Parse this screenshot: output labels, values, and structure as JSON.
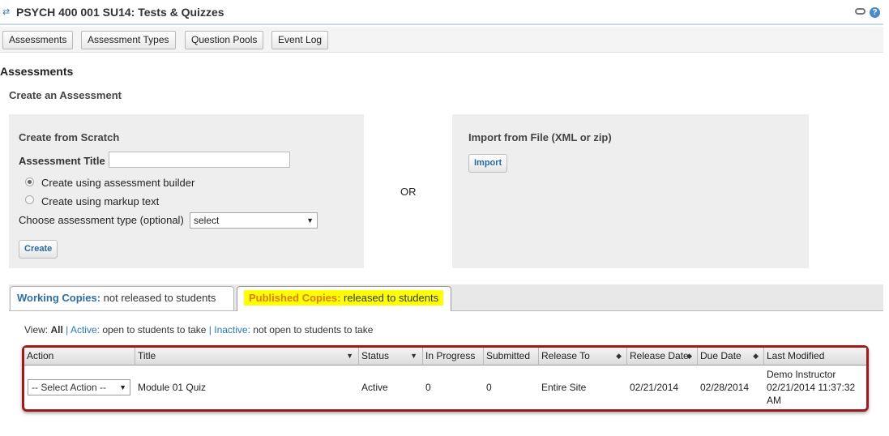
{
  "header": {
    "title": "PSYCH 400 001 SU14: Tests & Quizzes",
    "help_glyph": "?"
  },
  "nav": {
    "buttons": [
      "Assessments",
      "Assessment Types",
      "Question Pools",
      "Event Log"
    ]
  },
  "main": {
    "section_heading": "Assessments",
    "sub_heading": "Create an Assessment",
    "or_text": "OR"
  },
  "create_panel": {
    "title": "Create from Scratch",
    "title_label": "Assessment Title",
    "title_value": "",
    "radio_builder": "Create using assessment builder",
    "radio_markup": "Create using markup text",
    "selected_radio": "builder",
    "type_label": "Choose assessment type (optional)",
    "type_selected": "select",
    "create_button": "Create"
  },
  "import_panel": {
    "title": "Import from File (XML or zip)",
    "import_button": "Import"
  },
  "tabs": {
    "working_strong": "Working Copies:",
    "working_rest": "not released to students",
    "published_strong": "Published Copies:",
    "published_rest": "released to students",
    "active_tab": "published"
  },
  "view_filter": {
    "prefix": "View:",
    "all": "All",
    "sep": "|",
    "active": "Active:",
    "active_desc": "open to students to take",
    "inactive": "Inactive:",
    "inactive_desc": "not open to students to take"
  },
  "table": {
    "headers": [
      "Action",
      "Title",
      "Status",
      "In Progress",
      "Submitted",
      "Release To",
      "Release Date",
      "Due Date",
      "Last Modified"
    ],
    "rows": [
      {
        "action": "-- Select Action --",
        "title": "Module 01 Quiz",
        "status": "Active",
        "in_progress": "0",
        "submitted": "0",
        "release_to": "Entire Site",
        "release_date": "02/21/2014",
        "due_date": "02/28/2014",
        "modified_by": "Demo Instructor",
        "modified_date": "02/21/2014 11:37:32",
        "modified_ampm": "AM"
      }
    ]
  },
  "colors": {
    "accent_blue": "#2e6ea3",
    "highlight_yellow": "#ffff00",
    "published_orange": "#e07a10",
    "table_border_red": "#9c1c1c"
  },
  "icons": {
    "tool": "refresh-arrows-icon",
    "link": "link-icon",
    "help": "help-icon",
    "sort": "sort-arrows-icon",
    "dropdown": "chevron-down-icon"
  }
}
